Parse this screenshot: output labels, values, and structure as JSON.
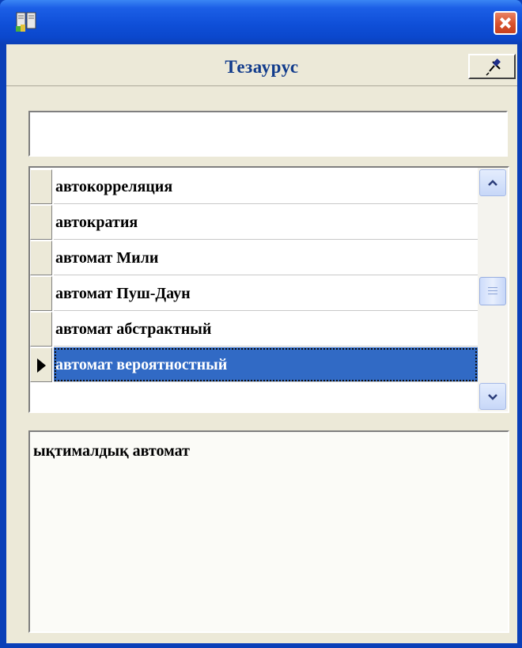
{
  "window": {
    "caption": "Тезаурус",
    "colors": {
      "titlebar": "#0b47cc",
      "selection": "#316ac5",
      "face": "#ece9d8",
      "caption_text": "#123c8c"
    },
    "icons": {
      "app": "book-icon",
      "close": "close-icon",
      "pin": "pin-icon"
    }
  },
  "search": {
    "value": "",
    "placeholder": ""
  },
  "list": {
    "items": [
      {
        "label": "автокорреляция"
      },
      {
        "label": "автократия"
      },
      {
        "label": "автомат Мили"
      },
      {
        "label": "автомат Пуш-Даун"
      },
      {
        "label": "автомат абстрактный"
      },
      {
        "label": "автомат вероятностный"
      }
    ],
    "selected_index": 5,
    "scroll_icons": {
      "up": "chevron-up-icon",
      "down": "chevron-down-icon",
      "thumb": "scroll-thumb"
    }
  },
  "detail": {
    "text": "ықтималдық автомат"
  }
}
